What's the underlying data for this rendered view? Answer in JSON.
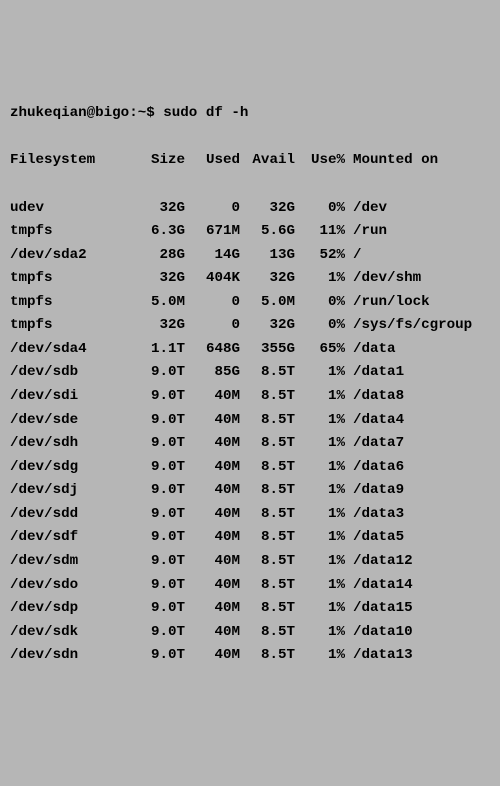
{
  "prompt": {
    "user_host": "zhukeqian@bigo",
    "path": "~",
    "symbol": "$",
    "command": "sudo df -h"
  },
  "headers": {
    "fs": "Filesystem",
    "size": "Size",
    "used": "Used",
    "avail": "Avail",
    "usep": "Use%",
    "mount": "Mounted on"
  },
  "rows": [
    {
      "fs": "udev",
      "size": "32G",
      "used": "0",
      "avail": "32G",
      "usep": "0%",
      "mount": "/dev"
    },
    {
      "fs": "tmpfs",
      "size": "6.3G",
      "used": "671M",
      "avail": "5.6G",
      "usep": "11%",
      "mount": "/run"
    },
    {
      "fs": "/dev/sda2",
      "size": "28G",
      "used": "14G",
      "avail": "13G",
      "usep": "52%",
      "mount": "/"
    },
    {
      "fs": "tmpfs",
      "size": "32G",
      "used": "404K",
      "avail": "32G",
      "usep": "1%",
      "mount": "/dev/shm"
    },
    {
      "fs": "tmpfs",
      "size": "5.0M",
      "used": "0",
      "avail": "5.0M",
      "usep": "0%",
      "mount": "/run/lock"
    },
    {
      "fs": "tmpfs",
      "size": "32G",
      "used": "0",
      "avail": "32G",
      "usep": "0%",
      "mount": "/sys/fs/cgroup"
    },
    {
      "fs": "/dev/sda4",
      "size": "1.1T",
      "used": "648G",
      "avail": "355G",
      "usep": "65%",
      "mount": "/data"
    },
    {
      "fs": "/dev/sdb",
      "size": "9.0T",
      "used": "85G",
      "avail": "8.5T",
      "usep": "1%",
      "mount": "/data1"
    },
    {
      "fs": "/dev/sdi",
      "size": "9.0T",
      "used": "40M",
      "avail": "8.5T",
      "usep": "1%",
      "mount": "/data8"
    },
    {
      "fs": "/dev/sde",
      "size": "9.0T",
      "used": "40M",
      "avail": "8.5T",
      "usep": "1%",
      "mount": "/data4"
    },
    {
      "fs": "/dev/sdh",
      "size": "9.0T",
      "used": "40M",
      "avail": "8.5T",
      "usep": "1%",
      "mount": "/data7"
    },
    {
      "fs": "/dev/sdg",
      "size": "9.0T",
      "used": "40M",
      "avail": "8.5T",
      "usep": "1%",
      "mount": "/data6"
    },
    {
      "fs": "/dev/sdj",
      "size": "9.0T",
      "used": "40M",
      "avail": "8.5T",
      "usep": "1%",
      "mount": "/data9"
    },
    {
      "fs": "/dev/sdd",
      "size": "9.0T",
      "used": "40M",
      "avail": "8.5T",
      "usep": "1%",
      "mount": "/data3"
    },
    {
      "fs": "/dev/sdf",
      "size": "9.0T",
      "used": "40M",
      "avail": "8.5T",
      "usep": "1%",
      "mount": "/data5"
    },
    {
      "fs": "/dev/sdm",
      "size": "9.0T",
      "used": "40M",
      "avail": "8.5T",
      "usep": "1%",
      "mount": "/data12"
    },
    {
      "fs": "/dev/sdo",
      "size": "9.0T",
      "used": "40M",
      "avail": "8.5T",
      "usep": "1%",
      "mount": "/data14"
    },
    {
      "fs": "/dev/sdp",
      "size": "9.0T",
      "used": "40M",
      "avail": "8.5T",
      "usep": "1%",
      "mount": "/data15"
    },
    {
      "fs": "/dev/sdk",
      "size": "9.0T",
      "used": "40M",
      "avail": "8.5T",
      "usep": "1%",
      "mount": "/data10"
    },
    {
      "fs": "/dev/sdn",
      "size": "9.0T",
      "used": "40M",
      "avail": "8.5T",
      "usep": "1%",
      "mount": "/data13"
    }
  ]
}
